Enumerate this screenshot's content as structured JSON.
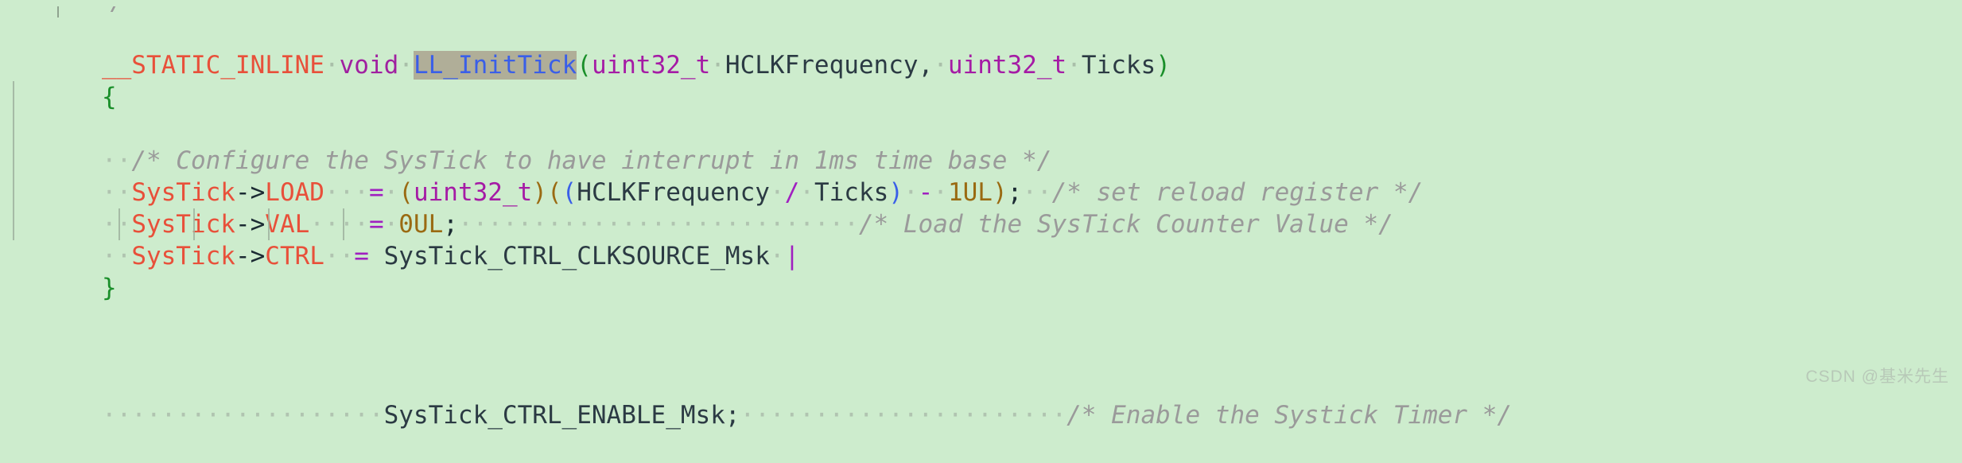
{
  "editor": {
    "background_color": "#cdeccd",
    "font_size_px": 31,
    "line_height_px": 40,
    "whitespace_dot": "·"
  },
  "colors": {
    "background": "#cdeccd",
    "macro_red": "#e8503a",
    "keyword_purple": "#a020a0",
    "function_blue": "#3a5fe8",
    "function_highlight_bg": "#b0ae98",
    "type_magenta": "#a51ba5",
    "identifier_dark": "#2b3a43",
    "operator_purple": "#a020c0",
    "number_brown": "#9a6a12",
    "comment_gray": "#9a9a9a",
    "brace_green": "#1a8f2a",
    "indent_guide": "#9fb39f",
    "whitespace_dot": "#a9bfa9",
    "watermark": "#b8c9b8"
  },
  "code": {
    "language": "C",
    "function_name": "LL_InitTick",
    "lines": [
      {
        "id": "line-top-partial",
        "text": "*/",
        "note": "partial previous line clipped at top"
      },
      {
        "id": "line-signature",
        "text": "__STATIC_INLINE void LL_InitTick(uint32_t HCLKFrequency, uint32_t Ticks)",
        "tokens": {
          "macro": "__STATIC_INLINE",
          "keyword": "void",
          "function": "LL_InitTick",
          "param_type_1": "uint32_t",
          "param_name_1": "HCLKFrequency",
          "param_type_2": "uint32_t",
          "param_name_2": "Ticks"
        }
      },
      {
        "id": "line-open-brace",
        "text": "{"
      },
      {
        "id": "line-comment-configure",
        "text": "  /* Configure the SysTick to have interrupt in 1ms time base */",
        "comment": "/* Configure the SysTick to have interrupt in 1ms time base */"
      },
      {
        "id": "line-systick-load",
        "text": "  SysTick->LOAD  = (uint32_t)((HCLKFrequency / Ticks) - 1UL);  /* set reload register */",
        "object": "SysTick",
        "member": "LOAD",
        "cast_type": "uint32_t",
        "expr_left": "HCLKFrequency",
        "expr_op": "/",
        "expr_right": "Ticks",
        "minus_value": "1UL",
        "trailing_comment": "/* set reload register */"
      },
      {
        "id": "line-systick-val",
        "text": "  SysTick->VAL   = 0UL;                              /* Load the SysTick Counter Value */",
        "object": "SysTick",
        "member": "VAL",
        "value": "0UL",
        "trailing_comment": "/* Load the SysTick Counter Value */"
      },
      {
        "id": "line-systick-ctrl",
        "text": "  SysTick->CTRL  = SysTick_CTRL_CLKSOURCE_Msk |",
        "object": "SysTick",
        "member": "CTRL",
        "value": "SysTick_CTRL_CLKSOURCE_Msk",
        "operator": "|"
      },
      {
        "id": "line-systick-ctrl-cont",
        "text": "                   SysTick_CTRL_ENABLE_Msk;               /* Enable the Systick Timer */",
        "value": "SysTick_CTRL_ENABLE_Msk;",
        "trailing_comment": "/* Enable the Systick Timer */"
      },
      {
        "id": "line-close-brace",
        "text": "}"
      }
    ]
  },
  "watermark": {
    "text": "CSDN @基米先生"
  }
}
